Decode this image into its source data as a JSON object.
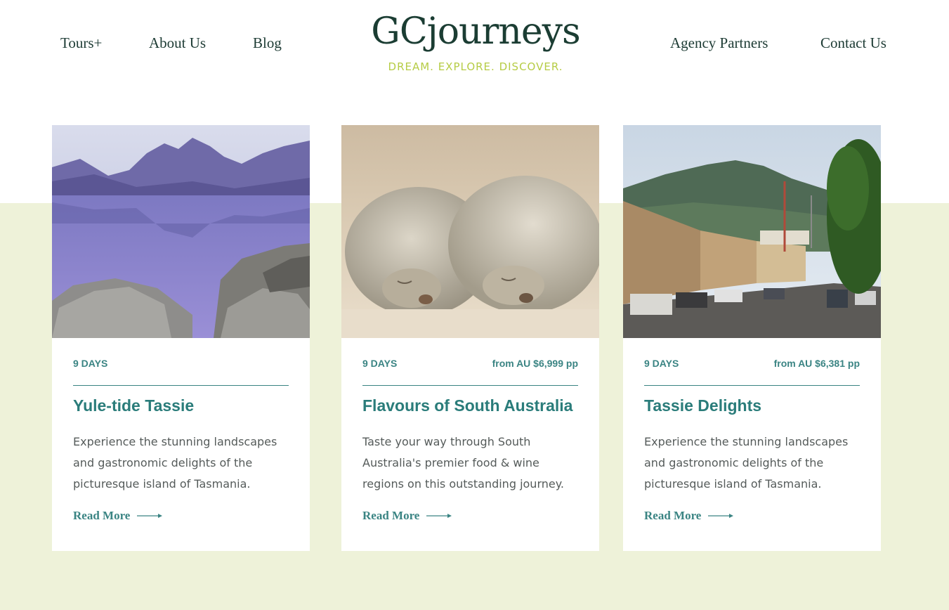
{
  "nav": {
    "tours": "Tours+",
    "about": "About Us",
    "blog": "Blog",
    "agency": "Agency Partners",
    "contact": "Contact Us"
  },
  "logo": {
    "text": "GCjourneys",
    "tagline": "DREAM. EXPLORE. DISCOVER."
  },
  "colors": {
    "brand_dark": "#1b3d33",
    "brand_lime": "#b6cc45",
    "accent_teal": "#2a7c7a",
    "band_background": "#eef2d9"
  },
  "cards": [
    {
      "days": "9 DAYS",
      "price": "",
      "title": "Yule-tide Tassie",
      "description": "Experience the stunning landscapes and gastronomic delights of the picturesque island of Tasmania.",
      "read_more": "Read More"
    },
    {
      "days": "9 DAYS",
      "price": "from AU $6,999 pp",
      "title": "Flavours of South Australia",
      "description": "Taste your way through South Australia's premier food & wine regions on this outstanding journey.",
      "read_more": "Read More"
    },
    {
      "days": "9 DAYS",
      "price": "from AU $6,381 pp",
      "title": "Tassie Delights",
      "description": "Experience the stunning landscapes and gastronomic delights of the picturesque island of Tasmania.",
      "read_more": "Read More"
    }
  ]
}
